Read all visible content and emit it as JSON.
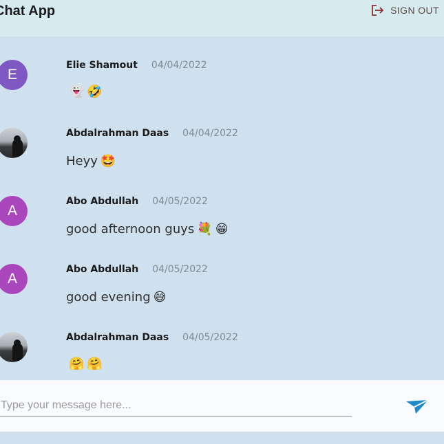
{
  "header": {
    "title": "Chat App",
    "signout_label": "SIGN OUT"
  },
  "messages": [
    {
      "author": "Elie Shamout",
      "date": "04/04/2022",
      "avatar_letter": "E",
      "avatar_color": "#7e57c2",
      "avatar_type": "letter",
      "text": "",
      "emojis": [
        "👻",
        "🤣"
      ]
    },
    {
      "author": "Abdalrahman Daas",
      "date": "04/04/2022",
      "avatar_letter": "",
      "avatar_color": "",
      "avatar_type": "photo",
      "text": "Heyy",
      "emojis": [
        "🤩"
      ]
    },
    {
      "author": "Abo Abdullah",
      "date": "04/05/2022",
      "avatar_letter": "A",
      "avatar_color": "#ab47bc",
      "avatar_type": "letter",
      "text": "good afternoon guys",
      "emojis": [
        "💐",
        "😁"
      ]
    },
    {
      "author": "Abo Abdullah",
      "date": "04/05/2022",
      "avatar_letter": "A",
      "avatar_color": "#ab47bc",
      "avatar_type": "letter",
      "text": "good evening",
      "emojis": [
        "😅"
      ]
    },
    {
      "author": "Abdalrahman Daas",
      "date": "04/05/2022",
      "avatar_letter": "",
      "avatar_color": "",
      "avatar_type": "photo",
      "text": "",
      "emojis": [
        "🤗",
        "🤗"
      ]
    }
  ],
  "composer": {
    "placeholder": "Type your message here...",
    "value": ""
  },
  "colors": {
    "header_bg": "#d5ebee",
    "chat_bg": "#cfe0ee",
    "send_icon": "#1e88c9",
    "signout_icon": "#8b2f2f"
  },
  "icons": {
    "signout": "logout-icon",
    "send": "send-icon"
  }
}
